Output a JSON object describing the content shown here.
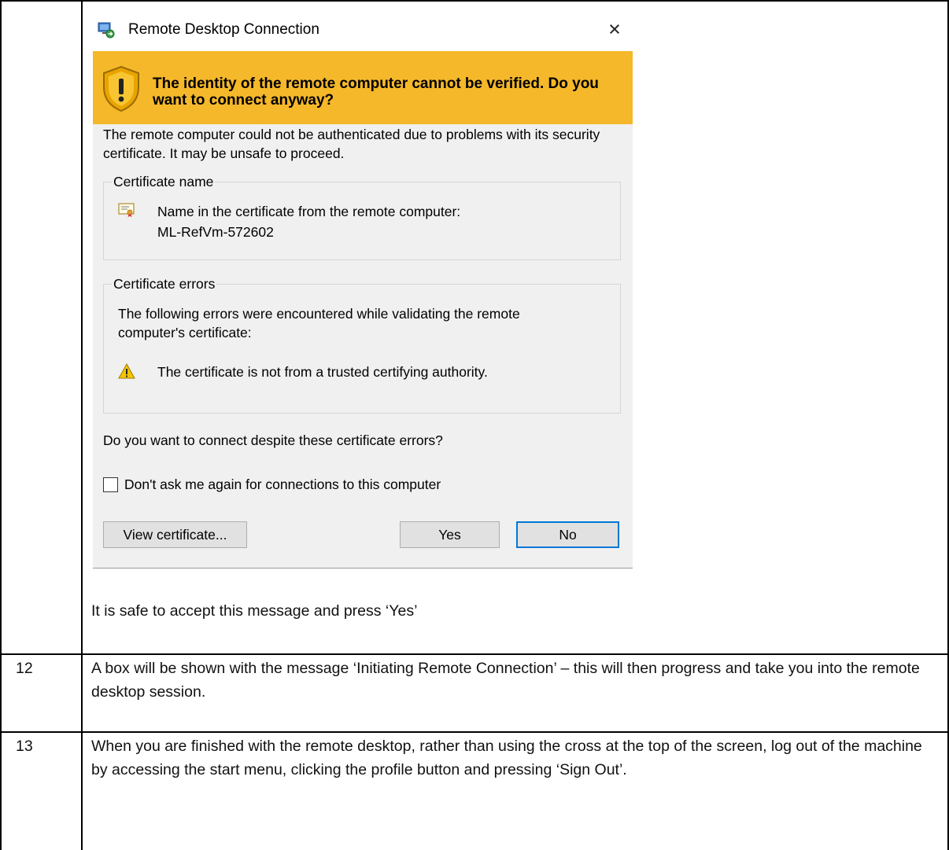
{
  "dialog": {
    "title": "Remote Desktop Connection",
    "close_glyph": "×",
    "headline": "The identity of the remote computer cannot be verified. Do you want to connect anyway?",
    "description": "The remote computer could not be authenticated due to problems with its security certificate. It may be unsafe to proceed.",
    "certificate_name_group": {
      "label": "Certificate name",
      "line1": "Name in the certificate from the remote computer:",
      "line2": "ML-RefVm-572602"
    },
    "certificate_errors_group": {
      "label": "Certificate errors",
      "intro": "The following errors were encountered while validating the remote computer's certificate:",
      "error_text": "The certificate is not from a trusted certifying authority."
    },
    "question": "Do you want to connect despite these certificate errors?",
    "checkbox_label": "Don't ask me again for connections to this computer",
    "checkbox_checked": false,
    "buttons": {
      "view_certificate": "View certificate...",
      "yes": "Yes",
      "no": "No"
    },
    "colors": {
      "warning_band": "#f5b82a",
      "default_button_border": "#0078d7"
    }
  },
  "document": {
    "step11_note": "It is safe to accept this message and press ‘Yes’",
    "rows": [
      {
        "number": "12",
        "text": "A box will be shown with the message ‘Initiating Remote Connection’ – this will then progress and take you into the remote desktop session."
      },
      {
        "number": "13",
        "text": "When you are finished with the remote desktop, rather than using the cross at the top of the screen, log out of the machine by accessing the start menu, clicking the profile button and pressing ‘Sign Out’."
      }
    ]
  }
}
